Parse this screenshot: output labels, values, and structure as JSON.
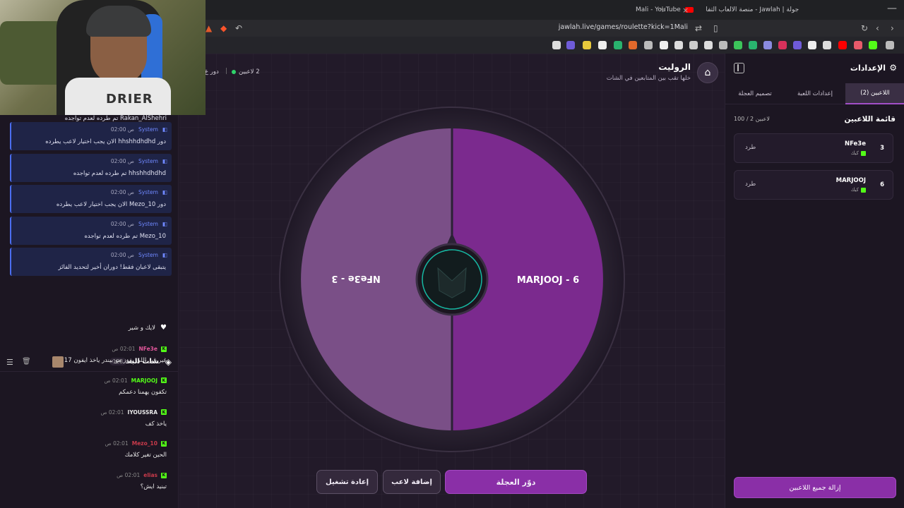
{
  "browser": {
    "active_tab_title": "جولة | Jawlah - منصة الألعاب التفا",
    "other_tab_title": "Mali - YouTube",
    "url": "jawlah.live/games/roulette?kick=1Mali"
  },
  "webcam": {
    "shirt_text": "DRIER"
  },
  "system_feed": {
    "top_text": "Rakan_AlShehri تم طرده لعدم تواجده",
    "messages": [
      {
        "sender": "System",
        "time": "02:00 ص",
        "text": "دور hhshhdhdhd الان يجب اختيار لاعب يطرده"
      },
      {
        "sender": "System",
        "time": "02:00 ص",
        "text": "hhshhdhdhd تم طرده لعدم تواجده"
      },
      {
        "sender": "System",
        "time": "02:00 ص",
        "text": "دور Mezo_10 الان يجب اختيار لاعب يطرده"
      },
      {
        "sender": "System",
        "time": "02:00 ص",
        "text": "Mezo_10 تم طرده لعدم تواجده"
      },
      {
        "sender": "System",
        "time": "02:00 ص",
        "text": "يتبقى لاعبان فقط! دوران أخير لتحديد الفائز"
      }
    ]
  },
  "chat": {
    "title": "شات البث",
    "count": "128",
    "pinned_text": "لايك و شير",
    "messages": [
      {
        "user": "NFe3e",
        "color": "#e0569a",
        "time": "02:01 ص",
        "text": "غير غير اللي يفوز مو بيندر ياخذ ايفون 17"
      },
      {
        "user": "MARJOOJ",
        "color": "#53fc18",
        "time": "02:01 ص",
        "text": "تكفون يهمنا دعمكم"
      },
      {
        "user": "IYOUSSRA",
        "color": "#e8e8e8",
        "time": "02:01 ص",
        "text": "ياخذ كف"
      },
      {
        "user": "Mezo_10",
        "color": "#c83a4a",
        "time": "02:01 ص",
        "text": "الحين تغير كلامك"
      },
      {
        "user": "elias",
        "color": "#c83a4a",
        "time": "02:01 ص",
        "text": "تبنيد ايش؟"
      }
    ]
  },
  "game": {
    "title": "الروليت",
    "subtitle": "خلها تقب بين المتابعين في الشات",
    "players_status": "2 لاعبين",
    "turn_status": "دور غ",
    "wheel_segments": [
      {
        "label": "MARJOOJ - 6",
        "color": "#7b2a8e"
      },
      {
        "label": "NFe3e - 3",
        "color": "#7a4f87"
      }
    ],
    "buttons": {
      "spin": "دوّر العجلة",
      "add_player": "إضافة لاعب",
      "restart": "إعادة تشغيل"
    }
  },
  "settings": {
    "title": "الإعدادات",
    "tabs": [
      "اللاعبين (2)",
      "إعدادات اللعبة",
      "تصميم العجلة"
    ],
    "list_title": "قائمة اللاعبين",
    "list_count": "100 / 2 لاعبين",
    "players": [
      {
        "number": "3",
        "name": "NFe3e",
        "platform": "كيك",
        "kick_label": "طرد"
      },
      {
        "number": "6",
        "name": "MARJOOJ",
        "platform": "كيك",
        "kick_label": "طرد"
      }
    ],
    "remove_all": "إزالة جميع اللاعبين"
  },
  "colors": {
    "accent": "#8a2fa7",
    "kick_green": "#53fc18",
    "system_blue": "#4b6ef0"
  }
}
